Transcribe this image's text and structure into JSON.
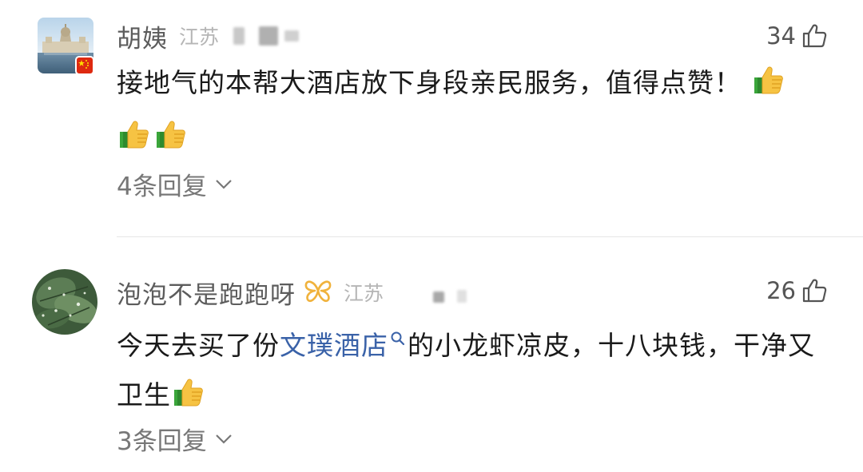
{
  "comments": [
    {
      "username": "胡姨",
      "location": "江苏",
      "likes": "34",
      "text": "接地气的本帮大酒店放下身段亲民服务，值得点赞！",
      "thumbs": 3,
      "replies_label": "4条回复"
    },
    {
      "username": "泡泡不是跑跑呀",
      "location": "江苏",
      "likes": "26",
      "text_before": "今天去买了份",
      "link_text": "文璞酒店",
      "text_after": "的小龙虾凉皮，十八块钱，干净又卫生",
      "thumbs": 1,
      "replies_label": "3条回复"
    }
  ],
  "colors": {
    "link": "#3a62a8",
    "username": "#5c5c5c",
    "secondary": "#b5b5b5",
    "badge_butterfly": "#f0b23c",
    "flag": "#de2910"
  },
  "icons": {
    "like": "thumbs-up-outline-icon",
    "search": "search-icon",
    "expand": "chevron-down-icon",
    "emoji": "thumbs-up-emoji-icon",
    "badge": "butterfly-badge-icon",
    "flag": "china-flag-icon"
  }
}
